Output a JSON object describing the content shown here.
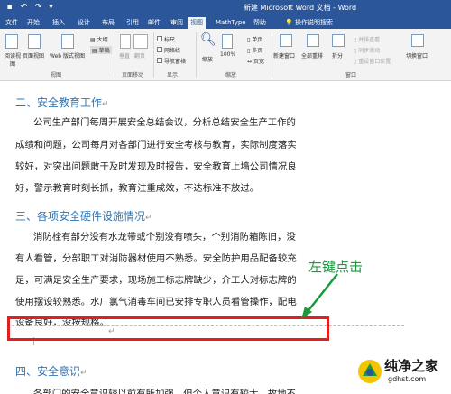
{
  "titlebar": {
    "title": "新建 Microsoft Word 文档 - Word",
    "save_icon": "save-icon",
    "undo_icon": "undo-icon",
    "redo_icon": "redo-icon",
    "customize_icon": "dropdown-icon"
  },
  "tabs": [
    "文件",
    "开始",
    "插入",
    "设计",
    "布局",
    "引用",
    "邮件",
    "审阅",
    "视图",
    "MathType",
    "帮助"
  ],
  "active_tab": "视图",
  "tell_me": "操作说明搜索",
  "ribbon": {
    "views": {
      "read_mode": "阅读视图",
      "print_layout": "页面视图",
      "web_layout": "Web 版式视图",
      "outline": "大纲",
      "draft": "草稿",
      "group_label": "视图"
    },
    "page_movement": {
      "vertical": "垂直",
      "side_to_side": "翻页",
      "group_label": "页面移动"
    },
    "show": {
      "ruler": "标尺",
      "gridlines": "网格线",
      "nav_pane": "导航窗格",
      "group_label": "显示"
    },
    "zoom": {
      "zoom": "缩放",
      "hundred": "100%",
      "one_page": "单页",
      "multi_page": "多页",
      "page_width": "页宽",
      "group_label": "缩放"
    },
    "window": {
      "new_window": "新建窗口",
      "arrange_all": "全部重排",
      "split": "拆分",
      "side_by_side": "并排查看",
      "sync_scroll": "同步滚动",
      "reset_position": "重设窗口位置",
      "switch_windows": "切换窗口",
      "group_label": "窗口"
    }
  },
  "document": {
    "heading2": "二、安全教育工作",
    "para2": [
      "公司生产部门每周开展安全总结会议，分析总结安全生产工作的",
      "成绩和问题，公司每月对各部门进行安全考核与教育，实际制度落实",
      "较好，对突出问题敢于及时发现及时报告，安全教育上墙公司情况良",
      "好，警示教育时刻长抓，教育注重成效，不达标准不放过。"
    ],
    "heading3": "三、各项安全硬件设施情况",
    "para3": [
      "消防栓有部分没有水龙带或个别没有喷头，个别消防箱陈旧，没",
      "有人看管，分部职工对消防器材使用不熟悉。安全防护用品配备较充",
      "足，可满足安全生产要求，现场施工标志牌缺少，介工人对标志牌的",
      "使用摆设较熟悉。水厂氯气消毒车间已安排专职人员看管操作，配电",
      "设备良好，没按规格。"
    ],
    "heading4": "四、安全意识",
    "para4": "各部门的安全意识较以前有所加强，但个人意识有较大，故地不"
  },
  "annotation": "左键点击",
  "watermark": {
    "text": "纯净之家",
    "url": "gdhst.com"
  },
  "colors": {
    "accent": "#2b579a",
    "heading": "#2e75b6",
    "highlight": "#e02020",
    "annotation": "#1a9a3c"
  }
}
